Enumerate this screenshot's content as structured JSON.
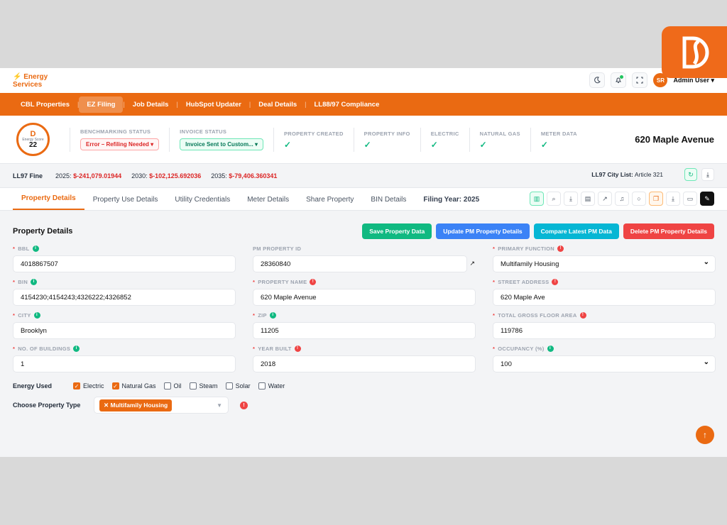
{
  "brand": {
    "line1": "⚡ Energy",
    "line2": "Services"
  },
  "user": {
    "initials": "SR",
    "name": "Admin User ▾"
  },
  "nav": [
    "CBL Properties",
    "EZ Filing",
    "Job Details",
    "HubSpot Updater",
    "Deal Details",
    "LL88/97 Compliance"
  ],
  "score": {
    "letter": "D",
    "label": "Energy Score",
    "value": "22"
  },
  "status": {
    "benchmarking_title": "BENCHMARKING STATUS",
    "benchmarking_value": "Error – Refiling Needed ▾",
    "invoice_title": "INVOICE STATUS",
    "invoice_value": "Invoice Sent to Custom... ▾",
    "checks": [
      {
        "title": "PROPERTY CREATED",
        "mark": "✓"
      },
      {
        "title": "PROPERTY INFO",
        "mark": "✓"
      },
      {
        "title": "ELECTRIC",
        "mark": "✓"
      },
      {
        "title": "NATURAL GAS",
        "mark": "✓"
      },
      {
        "title": "METER DATA",
        "mark": "✓"
      }
    ],
    "property_name": "620 Maple Avenue"
  },
  "ll97": {
    "label": "LL97 Fine",
    "y2025": "2025:",
    "v2025": "$-241,079.01944",
    "y2030": "2030:",
    "v2030": "$-102,125.692036",
    "y2035": "2035:",
    "v2035": "$-79,406.360341",
    "city_label": "LL97 City List:",
    "city_value": "Article 321"
  },
  "tabs": [
    "Property Details",
    "Property Use Details",
    "Utility Credentials",
    "Meter Details",
    "Share Property",
    "BIN Details",
    "Filing Year: 2025"
  ],
  "section": {
    "title": "Property Details",
    "buttons": [
      "Save Property Data",
      "Update PM Property Details",
      "Compare Latest PM Data",
      "Delete PM Property Details"
    ]
  },
  "fields": {
    "bbl": {
      "label": "BBL",
      "value": "4018867507"
    },
    "pm_id": {
      "label": "PM PROPERTY ID",
      "value": "28360840"
    },
    "primary_function": {
      "label": "PRIMARY FUNCTION",
      "value": "Multifamily Housing"
    },
    "bin": {
      "label": "BIN",
      "value": "4154230;4154243;4326222;4326852"
    },
    "property_name": {
      "label": "PROPERTY NAME",
      "value": "620 Maple Avenue"
    },
    "street": {
      "label": "STREET ADDRESS",
      "value": "620 Maple Ave"
    },
    "city": {
      "label": "CITY",
      "value": "Brooklyn"
    },
    "zip": {
      "label": "ZIP",
      "value": "11205"
    },
    "gfa": {
      "label": "TOTAL GROSS FLOOR AREA",
      "value": "119786"
    },
    "buildings": {
      "label": "NO. OF BUILDINGS",
      "value": "1"
    },
    "year_built": {
      "label": "YEAR BUILT",
      "value": "2018"
    },
    "occupancy": {
      "label": "OCCUPANCY (%)",
      "value": "100"
    }
  },
  "energy": {
    "label": "Energy Used",
    "options": [
      {
        "name": "Electric",
        "checked": true
      },
      {
        "name": "Natural Gas",
        "checked": true
      },
      {
        "name": "Oil",
        "checked": false
      },
      {
        "name": "Steam",
        "checked": false
      },
      {
        "name": "Solar",
        "checked": false
      },
      {
        "name": "Water",
        "checked": false
      }
    ]
  },
  "ptype": {
    "label": "Choose Property Type",
    "tag": "✕ Multifamily Housing"
  },
  "colors": {
    "accent": "#ea6a12",
    "success": "#10b981",
    "danger": "#ef4444",
    "info": "#3b82f6",
    "cyan": "#06b6d4"
  }
}
